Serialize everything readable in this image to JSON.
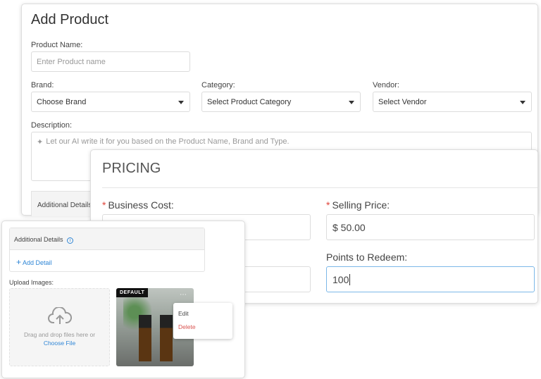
{
  "add_product": {
    "title": "Add Product",
    "product_name_label": "Product Name:",
    "product_name_placeholder": "Enter Product name",
    "brand_label": "Brand:",
    "brand_value": "Choose Brand",
    "category_label": "Category:",
    "category_value": "Select Product Category",
    "vendor_label": "Vendor:",
    "vendor_value": "Select Vendor",
    "description_label": "Description:",
    "description_placeholder": "Let our AI write it for you based on the Product Name, Brand and Type.",
    "additional_details": "Additional Details"
  },
  "pricing": {
    "title": "PRICING",
    "business_cost_label": "Business Cost:",
    "business_cost_value": "",
    "selling_price_label": "Selling Price:",
    "selling_price_value": "$ 50.00",
    "points_label": "Points to Redeem:",
    "points_value": "100",
    "required_mark": "*"
  },
  "details": {
    "additional_details": "Additional Details",
    "add_detail": "Add Detail",
    "upload_label": "Upload Images:",
    "drop_text": "Drag and drop files here or",
    "choose_file": "Choose File",
    "default_badge": "DEFAULT",
    "menu": {
      "edit": "Edit",
      "delete": "Delete"
    }
  },
  "colors": {
    "accent": "#2f86d6",
    "danger": "#d9534f",
    "required": "#e0443a"
  }
}
